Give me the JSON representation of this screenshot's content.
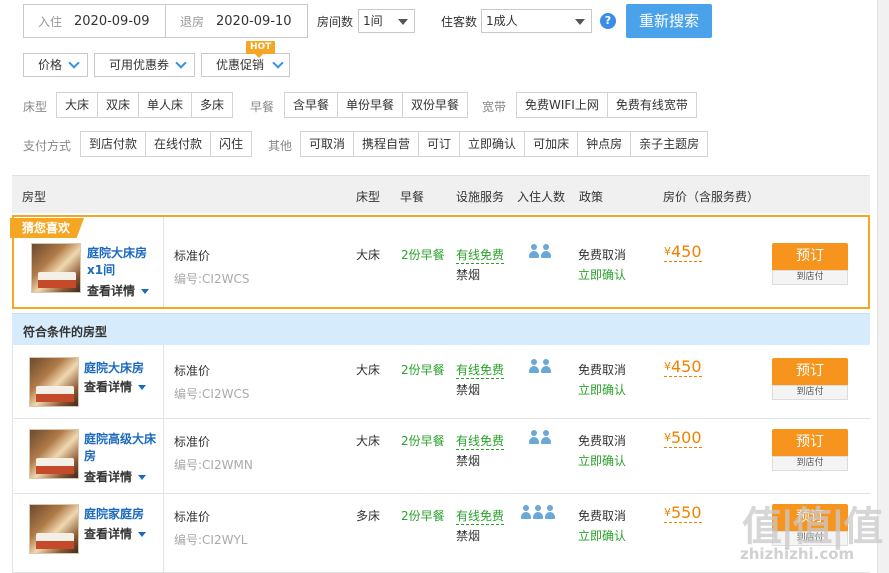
{
  "search": {
    "checkin_label": "入住",
    "checkin_date": "2020-09-09",
    "checkout_label": "退房",
    "checkout_date": "2020-09-10",
    "rooms_label": "房间数",
    "rooms_value": "1间",
    "guests_label": "住客数",
    "guests_value": "1成人",
    "help_icon": "?",
    "search_button": "重新搜索"
  },
  "dropdowns": {
    "price": "价格",
    "coupon": "可用优惠券",
    "promo": "优惠促销",
    "hot_badge": "HOT"
  },
  "filters": {
    "bed_label": "床型",
    "bed_options": [
      "大床",
      "双床",
      "单人床",
      "多床"
    ],
    "breakfast_label": "早餐",
    "breakfast_options": [
      "含早餐",
      "单份早餐",
      "双份早餐"
    ],
    "broadband_label": "宽带",
    "broadband_options": [
      "免费WIFI上网",
      "免费有线宽带"
    ],
    "payment_label": "支付方式",
    "payment_options": [
      "到店付款",
      "在线付款",
      "闪住"
    ],
    "other_label": "其他",
    "other_options": [
      "可取消",
      "携程自营",
      "可订",
      "立即确认",
      "可加床",
      "钟点房",
      "亲子主题房"
    ]
  },
  "table_header": {
    "room_type": "房型",
    "bed": "床型",
    "breakfast": "早餐",
    "facilities": "设施服务",
    "guests": "入住人数",
    "policy": "政策",
    "price": "房价（含服务费）"
  },
  "guess_tag": "猜您喜欢",
  "section_title": "符合条件的房型",
  "featured": {
    "name": "庭院大床房x1间",
    "detail": "查看详情",
    "plan": "标准价",
    "code": "编号:CI2WCS",
    "bed": "大床",
    "breakfast": "2份早餐",
    "facility": "有线免费",
    "smoking": "禁烟",
    "guests": 2,
    "cancel": "免费取消",
    "confirm": "立即确认",
    "currency": "¥",
    "price": "450",
    "book": "预订",
    "pay": "到店付"
  },
  "rooms": [
    {
      "name": "庭院大床房",
      "detail": "查看详情",
      "plan": "标准价",
      "code": "编号:CI2WCS",
      "bed": "大床",
      "breakfast": "2份早餐",
      "facility": "有线免费",
      "smoking": "禁烟",
      "guests": 2,
      "cancel": "免费取消",
      "confirm": "立即确认",
      "currency": "¥",
      "price": "450",
      "book": "预订",
      "pay": "到店付"
    },
    {
      "name": "庭院高级大床房",
      "detail": "查看详情",
      "plan": "标准价",
      "code": "编号:CI2WMN",
      "bed": "大床",
      "breakfast": "2份早餐",
      "facility": "有线免费",
      "smoking": "禁烟",
      "guests": 2,
      "cancel": "免费取消",
      "confirm": "立即确认",
      "currency": "¥",
      "price": "500",
      "book": "预订",
      "pay": "到店付"
    },
    {
      "name": "庭院家庭房",
      "detail": "查看详情",
      "plan": "标准价",
      "code": "编号:CI2WYL",
      "bed": "多床",
      "breakfast": "2份早餐",
      "facility": "有线免费",
      "smoking": "禁烟",
      "guests": 3,
      "cancel": "免费取消",
      "confirm": "立即确认",
      "currency": "¥",
      "price": "550",
      "book": "预订",
      "pay": "到店付"
    }
  ],
  "watermark": {
    "logo": "值|值|值",
    "url": "zhizhizhi.com"
  }
}
